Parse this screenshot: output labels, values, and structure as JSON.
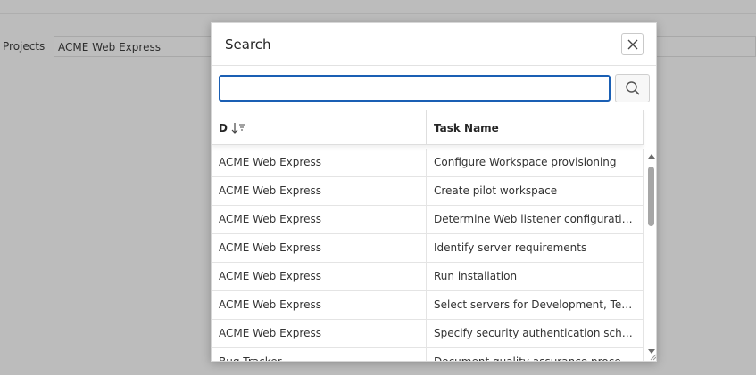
{
  "background": {
    "projects_label": "Projects",
    "projects_value": "ACME Web Express"
  },
  "dialog": {
    "title": "Search",
    "search": {
      "value": "",
      "placeholder": ""
    },
    "columns": {
      "col1": "D",
      "col2": "Task Name"
    },
    "rows": [
      {
        "project": "ACME Web Express",
        "task": "Configure Workspace provisioning"
      },
      {
        "project": "ACME Web Express",
        "task": "Create pilot workspace"
      },
      {
        "project": "ACME Web Express",
        "task": "Determine Web listener configuration(s)"
      },
      {
        "project": "ACME Web Express",
        "task": "Identify server requirements"
      },
      {
        "project": "ACME Web Express",
        "task": "Run installation"
      },
      {
        "project": "ACME Web Express",
        "task": "Select servers for Development, Test, Production"
      },
      {
        "project": "ACME Web Express",
        "task": "Specify security authentication scheme(s)"
      },
      {
        "project": "Bug Tracker",
        "task": "Document quality assurance procedures"
      }
    ]
  },
  "icons": {
    "close": "close-icon",
    "search": "search-icon",
    "sort": "sort-descending-icon"
  },
  "colors": {
    "accent": "#1a5fb4",
    "overlay": "#bcbcbc"
  }
}
